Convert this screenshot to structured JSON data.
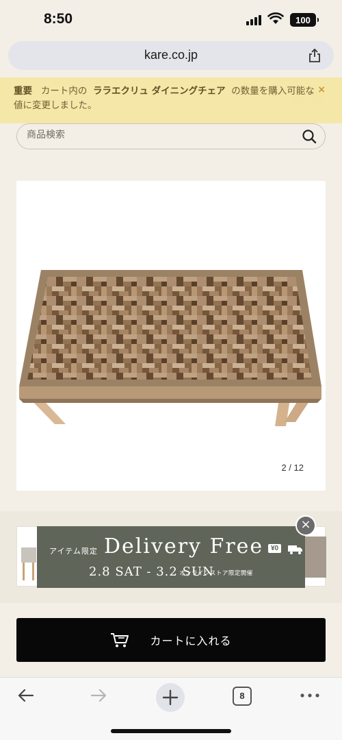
{
  "status_bar": {
    "time": "8:50",
    "battery": "100"
  },
  "browser": {
    "url": "kare.co.jp",
    "tab_count": "8"
  },
  "notice": {
    "label": "重要",
    "text_before": "カート内の",
    "item_name": "ララエクリュ ダイニングチェア",
    "text_after": "の数量を購入可能な値に変更しました。",
    "close": "×"
  },
  "search": {
    "placeholder": "商品検索"
  },
  "product": {
    "image_counter": "2 / 12"
  },
  "promo": {
    "tag": "アイテム限定",
    "headline": "Delivery Free",
    "badge": "¥0",
    "dates": "2.8 SAT - 3.2 SUN",
    "subtext": "オンラインストア限定開催",
    "close": "×"
  },
  "cart_button": {
    "label": "カートに入れる"
  },
  "colors": {
    "background": "#f3efe7",
    "notice_bg": "#f6e7a5",
    "promo_bg": "#5f6558",
    "cart_bg": "#080808"
  }
}
